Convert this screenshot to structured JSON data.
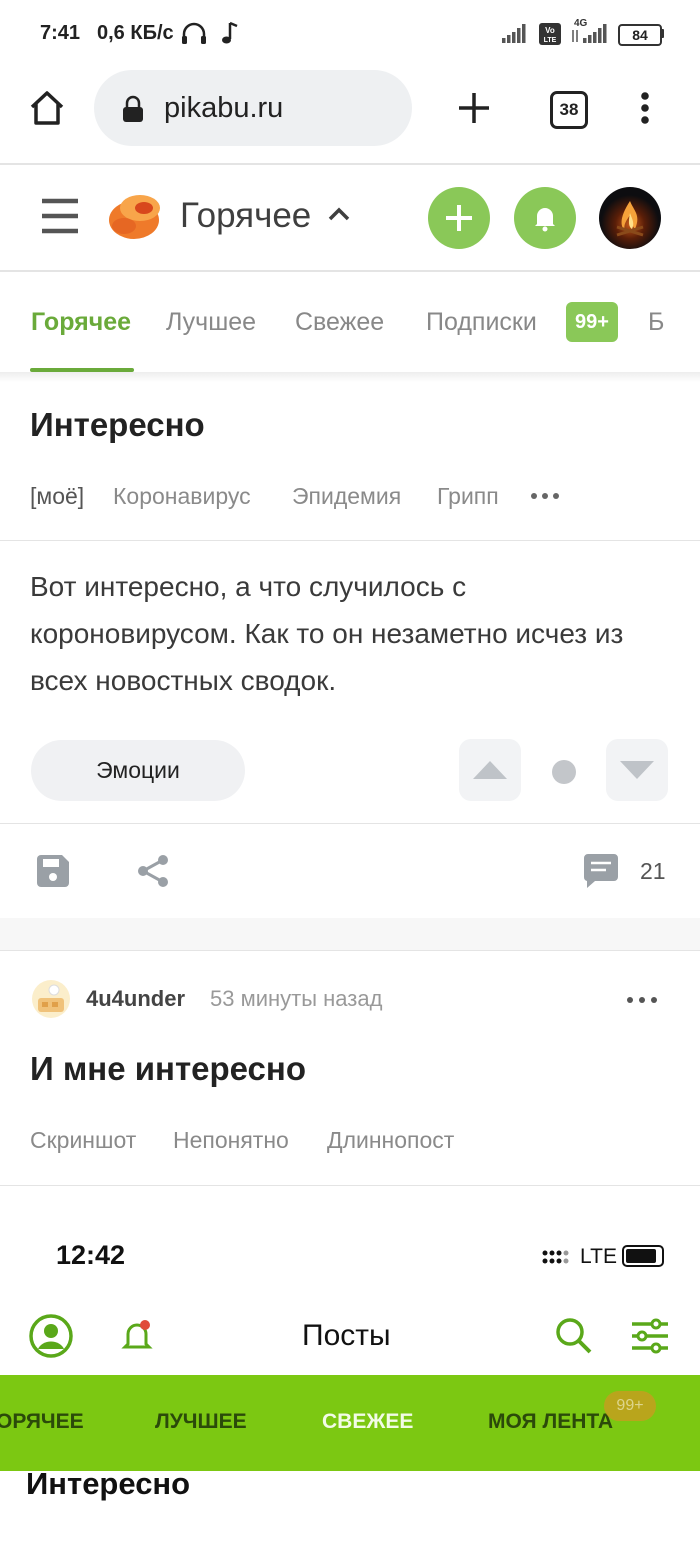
{
  "status_bar": {
    "time": "7:41",
    "speed": "0,6 КБ/с",
    "battery": "84",
    "network_4g": "4G"
  },
  "browser": {
    "url": "pikabu.ru",
    "tabs_count": "38"
  },
  "header": {
    "title": "Горячее"
  },
  "tabs": [
    {
      "label": "Горячее",
      "active": true
    },
    {
      "label": "Лучшее"
    },
    {
      "label": "Свежее"
    },
    {
      "label": "Подписки"
    },
    {
      "label": "Б"
    }
  ],
  "subscriptions_badge": "99+",
  "post1": {
    "title": "Интересно",
    "tags": [
      "[моё]",
      "Коронавирус",
      "Эпидемия",
      "Грипп"
    ],
    "text": "Вот интересно, а что случилось с короновирусом. Как то он незаметно исчез из всех новостных сводок.",
    "emotions_label": "Эмоции",
    "comments_count": "21"
  },
  "post2": {
    "author": "4u4under",
    "time": "53 минуты назад",
    "title": "И мне интересно",
    "tags": [
      "Скриншот",
      "Непонятно",
      "Длиннопост"
    ]
  },
  "embedded": {
    "time": "12:42",
    "network": "LTE",
    "title": "Посты",
    "tabs": [
      {
        "label": "ОРЯЧЕЕ"
      },
      {
        "label": "ЛУЧШЕЕ"
      },
      {
        "label": "СВЕЖЕЕ",
        "active": true
      },
      {
        "label": "МОЯ ЛЕНТА"
      }
    ],
    "badge": "99+",
    "post_title": "Интересно"
  },
  "colors": {
    "accent": "#8ac858",
    "accent_dark": "#6aaa3a",
    "embedded_band": "#7cc812"
  }
}
